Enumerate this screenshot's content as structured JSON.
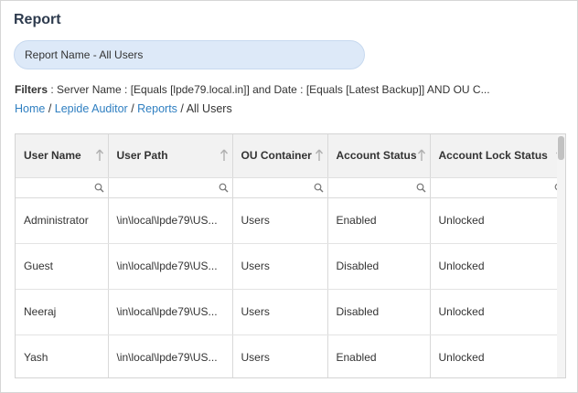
{
  "page": {
    "title": "Report",
    "report_name": "Report Name - All Users",
    "filters_label": "Filters",
    "filters_text": " : Server Name : [Equals [lpde79.local.in]] and Date : [Equals [Latest Backup]] AND OU C..."
  },
  "breadcrumb": {
    "items": [
      "Home",
      "Lepide Auditor",
      "Reports"
    ],
    "current": "All Users",
    "separator": "/"
  },
  "table": {
    "columns": [
      "User Name",
      "User Path",
      "OU Container",
      "Account Status",
      "Account Lock Status"
    ],
    "rows": [
      [
        "Administrator",
        "\\in\\local\\lpde79\\US...",
        "Users",
        "Enabled",
        "Unlocked"
      ],
      [
        "Guest",
        "\\in\\local\\lpde79\\US...",
        "Users",
        "Disabled",
        "Unlocked"
      ],
      [
        "Neeraj",
        "\\in\\local\\lpde79\\US...",
        "Users",
        "Disabled",
        "Unlocked"
      ],
      [
        "Yash",
        "\\in\\local\\lpde79\\US...",
        "Users",
        "Enabled",
        "Unlocked"
      ]
    ]
  },
  "icons": {
    "sort": "arrow-up-icon",
    "filter": "search-icon"
  },
  "colors": {
    "link": "#2f7fc1",
    "pill_bg": "#dde9f8",
    "header_bg": "#f2f2f2",
    "title": "#2e3b4e"
  }
}
